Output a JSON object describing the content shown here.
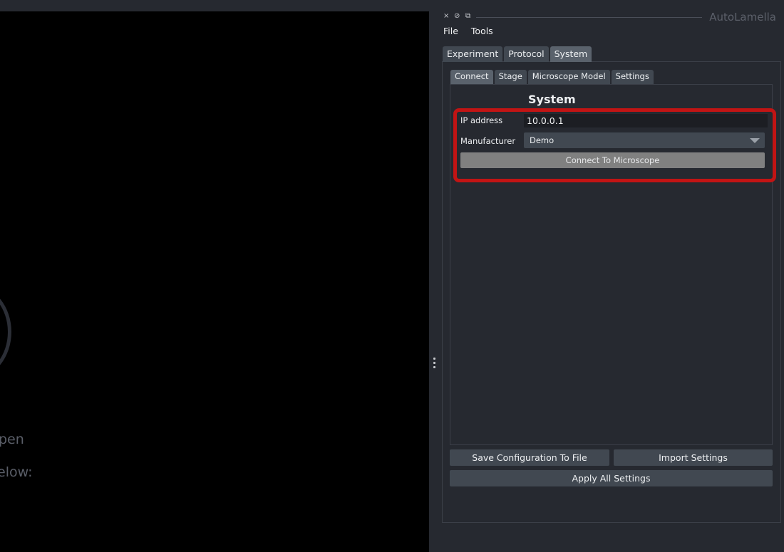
{
  "window": {
    "dock_title": "AutoLamella"
  },
  "dock_controls": {
    "close_icon": "×",
    "float_icon": "⊘",
    "maximize_icon": "⧉"
  },
  "menubar": {
    "items": [
      "File",
      "Tools"
    ]
  },
  "main_tabs": [
    {
      "label": "Experiment",
      "active": false
    },
    {
      "label": "Protocol",
      "active": false
    },
    {
      "label": "System",
      "active": true
    }
  ],
  "sub_tabs": [
    {
      "label": "Connect",
      "active": true
    },
    {
      "label": "Stage",
      "active": false
    },
    {
      "label": "Microscope Model",
      "active": false
    },
    {
      "label": "Settings",
      "active": false
    }
  ],
  "system": {
    "title": "System",
    "ip_label": "IP address",
    "ip_value": "10.0.0.1",
    "manufacturer_label": "Manufacturer",
    "manufacturer_value": "Demo",
    "connect_button": "Connect To Microscope",
    "highlight_color": "#c21414"
  },
  "footer": {
    "save_button": "Save Configuration To File",
    "import_button": "Import Settings",
    "apply_button": "Apply All Settings"
  },
  "canvas": {
    "hint_line1": "pen",
    "hint_line2": "elow:"
  }
}
